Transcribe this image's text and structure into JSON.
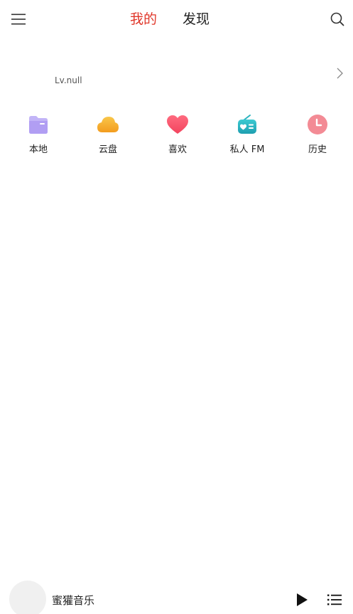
{
  "header": {
    "menu_icon": "hamburger-menu-icon",
    "tabs": [
      {
        "label": "我的",
        "active": true
      },
      {
        "label": "发现",
        "active": false
      }
    ],
    "search_icon": "search-icon",
    "active_color": "#e0372a"
  },
  "profile": {
    "level": "Lv.null",
    "chevron_icon": "chevron-right-icon"
  },
  "shortcuts": [
    {
      "label": "本地",
      "icon": "folder-icon",
      "color": "#b7a8f5"
    },
    {
      "label": "云盘",
      "icon": "cloud-icon",
      "color": "#f7b23b"
    },
    {
      "label": "喜欢",
      "icon": "heart-icon",
      "color": "#f5566f"
    },
    {
      "label": "私人 FM",
      "icon": "radio-icon",
      "color": "#2bb3bf"
    },
    {
      "label": "历史",
      "icon": "clock-icon",
      "color": "#f38b95"
    }
  ],
  "player": {
    "title": "蜜獾音乐",
    "play_icon": "play-icon",
    "playlist_icon": "playlist-icon"
  }
}
